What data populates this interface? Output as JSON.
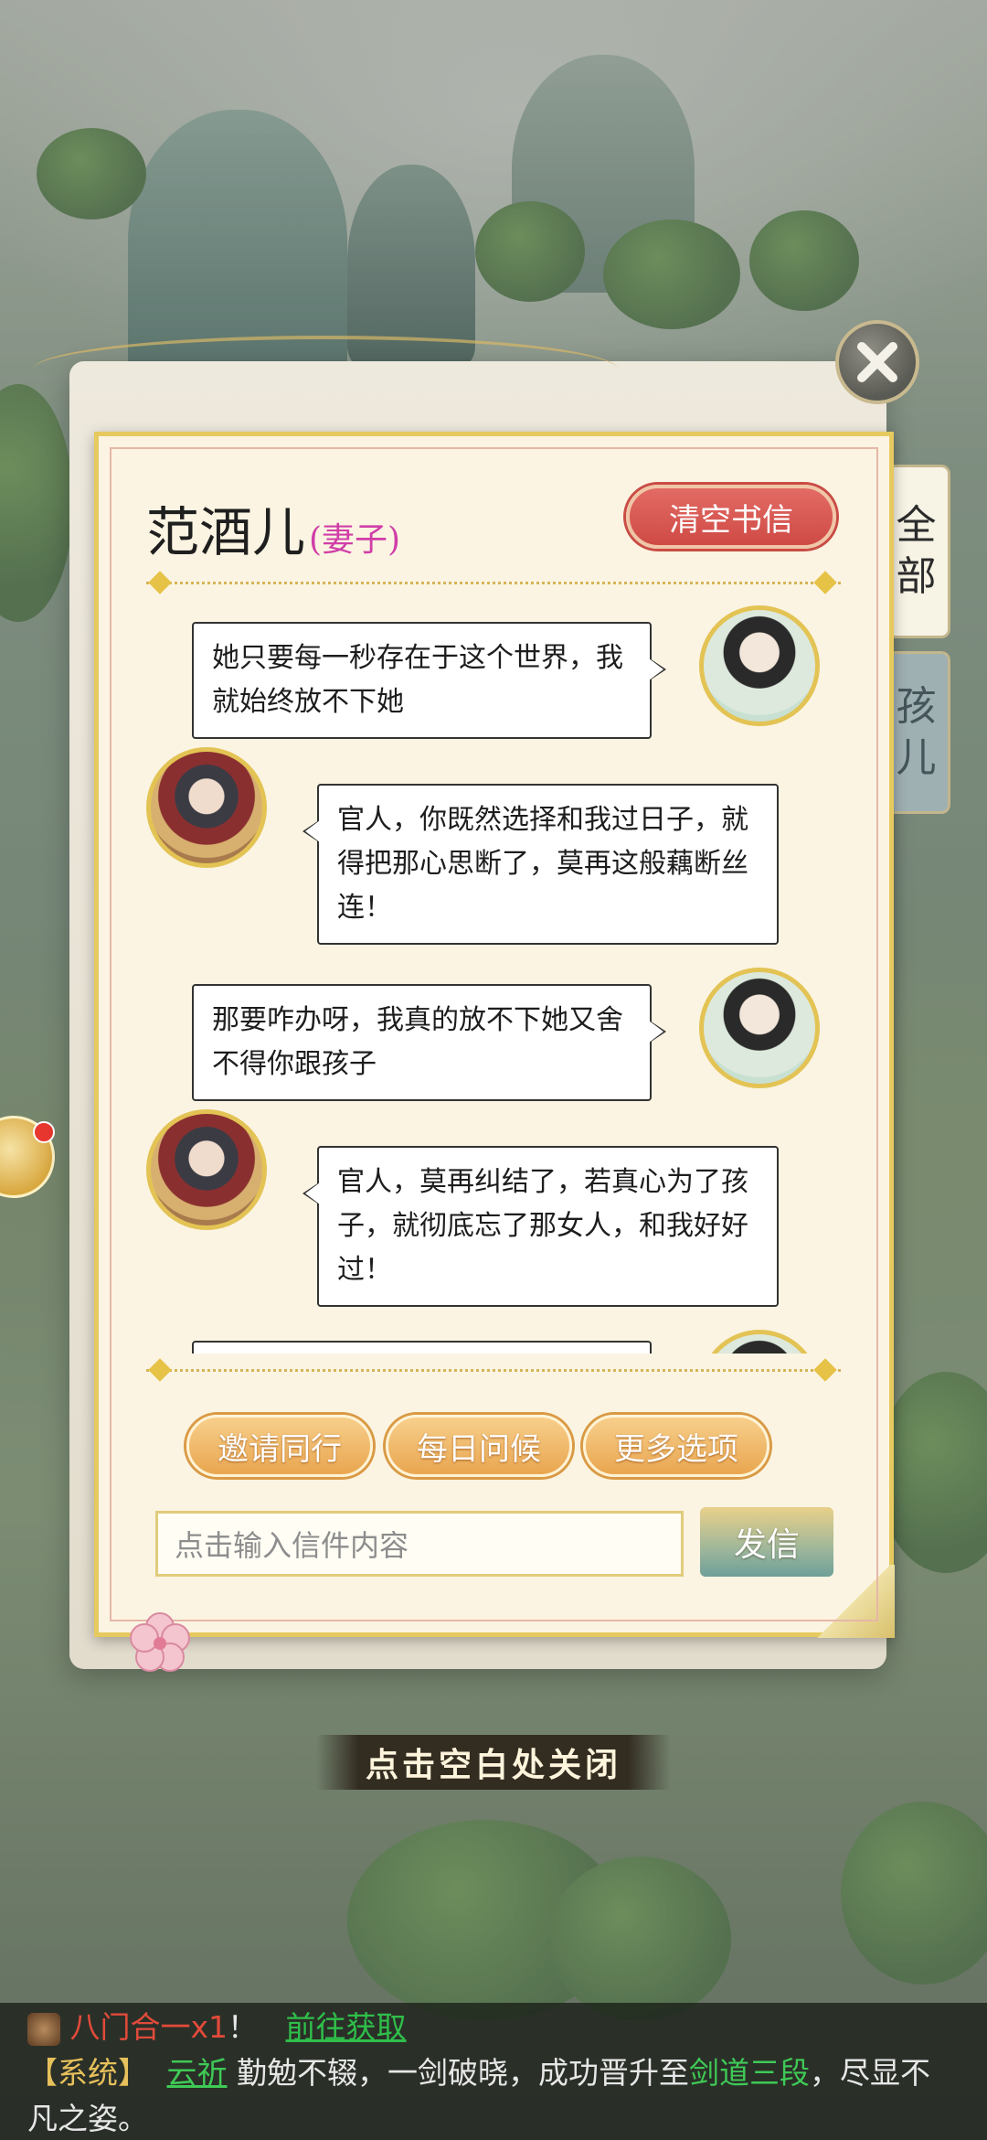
{
  "dialog": {
    "contact_name": "范酒儿",
    "relation": "(妻子)",
    "clear_button": "清空书信",
    "side_tabs": {
      "all": "全部",
      "children": "孩儿"
    },
    "messages": [
      {
        "sender": "player",
        "text": "她只要每一秒存在于这个世界，我就始终放不下她"
      },
      {
        "sender": "wife",
        "text": "官人，你既然选择和我过日子，就得把那心思断了，莫再这般藕断丝连！"
      },
      {
        "sender": "player",
        "text": "那要咋办呀，我真的放不下她又舍不得你跟孩子"
      },
      {
        "sender": "wife",
        "text": "官人，莫再纠结了，若真心为了孩子，就彻底忘了那女人，和我好好过！"
      }
    ],
    "actions": {
      "invite": "邀请同行",
      "daily_greeting": "每日问候",
      "more_options": "更多选项"
    },
    "input_placeholder": "点击输入信件内容",
    "send_button": "发信"
  },
  "close_hint": "点击空白处关闭",
  "feed": {
    "reward_item": "八门合一x1",
    "reward_suffix": "！",
    "reward_link": "前往获取",
    "system_tag": "【系统】",
    "player_name": "云祈",
    "text_1": "勤勉不辍，一剑破晓，成功晋升至",
    "rank": "剑道三段",
    "text_2": "，尽显不凡之姿。"
  }
}
